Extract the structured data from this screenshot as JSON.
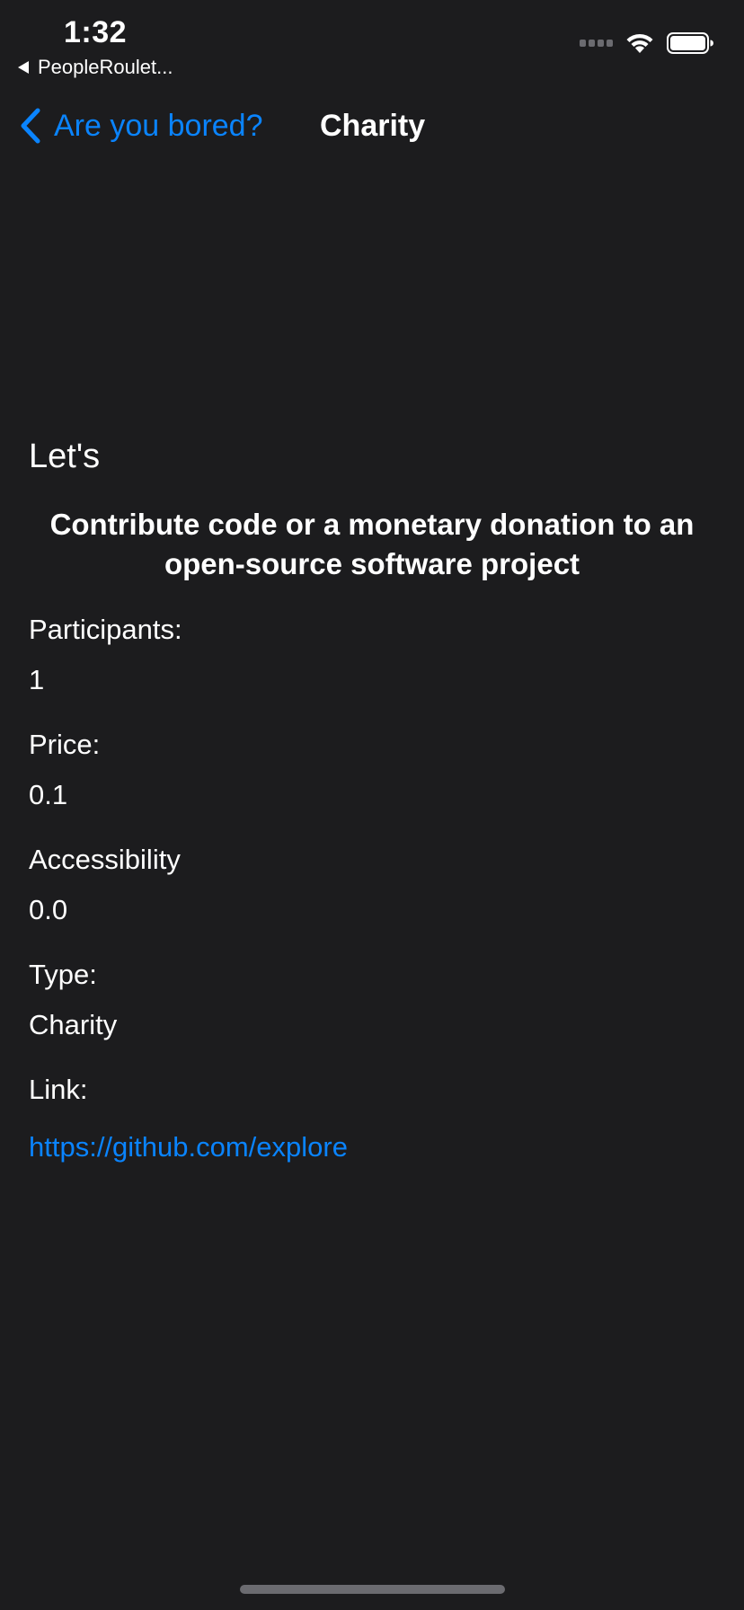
{
  "status_bar": {
    "time": "1:32",
    "back_app": "PeopleRoulet..."
  },
  "nav": {
    "back_label": "Are you bored?",
    "title": "Charity"
  },
  "content": {
    "intro": "Let's",
    "activity": "Contribute code or a monetary donation to an open-source software project",
    "details": {
      "participants_label": "Participants:",
      "participants_value": "1",
      "price_label": "Price:",
      "price_value": "0.1",
      "accessibility_label": "Accessibility",
      "accessibility_value": "0.0",
      "type_label": "Type:",
      "type_value": "Charity",
      "link_label": "Link:",
      "link_value": "https://github.com/explore"
    }
  },
  "colors": {
    "background": "#1c1c1e",
    "accent": "#0a84ff",
    "text": "#ffffff"
  }
}
